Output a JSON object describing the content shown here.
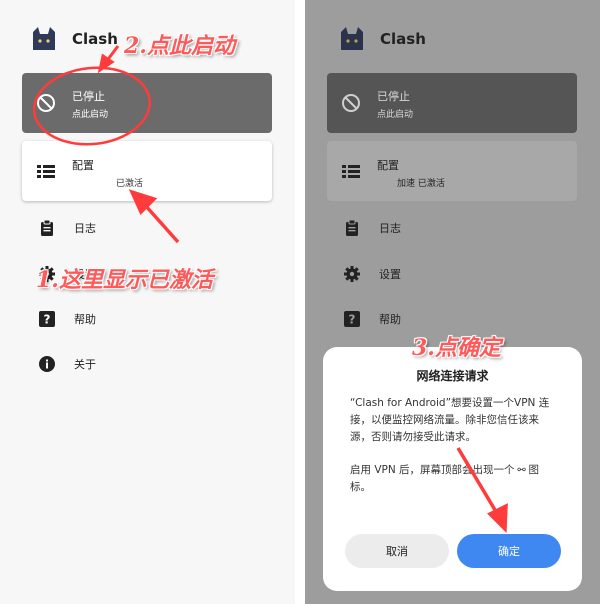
{
  "left": {
    "app_title": "Clash",
    "status": {
      "title": "已停止",
      "subtitle": "点此启动"
    },
    "profile": {
      "title": "配置",
      "subtitle": "已激活"
    },
    "menu": [
      {
        "icon": "clipboard-icon",
        "label": "日志"
      },
      {
        "icon": "gear-icon",
        "label": "设置"
      },
      {
        "icon": "help-icon",
        "label": "帮助"
      },
      {
        "icon": "info-icon",
        "label": "关于"
      }
    ]
  },
  "right": {
    "app_title": "Clash",
    "status": {
      "title": "已停止",
      "subtitle": "点此启动"
    },
    "profile": {
      "title": "配置",
      "subtitle": "加速 已激活"
    },
    "menu": [
      {
        "icon": "clipboard-icon",
        "label": "日志"
      },
      {
        "icon": "gear-icon",
        "label": "设置"
      },
      {
        "icon": "help-icon",
        "label": "帮助"
      }
    ]
  },
  "annotations": {
    "step1": "1.这里显示已激活",
    "step2": "2.点此启动",
    "step3": "3.点确定"
  },
  "dialog": {
    "title": "网络连接请求",
    "paragraph1": "“Clash for Android”想要设置一个VPN 连接，以便监控网络流量。除非您信任该来源，否则请勿接受此请求。",
    "paragraph2_before": "启用 VPN 后，屏幕顶部会出现一个",
    "paragraph2_after": "图标。",
    "cancel_label": "取消",
    "ok_label": "确定"
  },
  "colors": {
    "annotation": "#ff5a5a",
    "primary_button": "#3f88f2",
    "status_card_stopped": "#6b6b6b",
    "overlay": "#9d9d9d"
  }
}
